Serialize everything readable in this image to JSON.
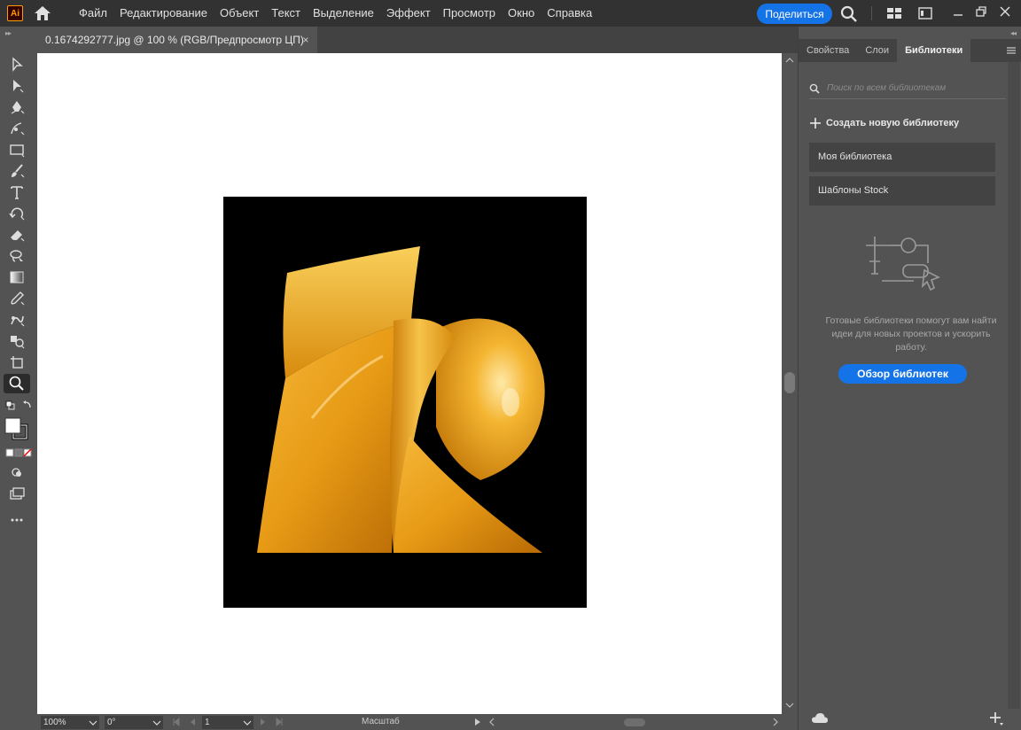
{
  "app": {
    "logo": "Ai",
    "menu": [
      "Файл",
      "Редактирование",
      "Объект",
      "Текст",
      "Выделение",
      "Эффект",
      "Просмотр",
      "Окно",
      "Справка"
    ],
    "share_label": "Поделиться",
    "accent": "#1473e6"
  },
  "document": {
    "tab_title": "0.1674292777.jpg @ 100 % (RGB/Предпросмотр ЦП)",
    "close_glyph": "×"
  },
  "status": {
    "zoom": "100%",
    "rotation": "0°",
    "page": "1",
    "scale_label": "Масштаб"
  },
  "panel": {
    "tabs": [
      "Свойства",
      "Слои",
      "Библиотеки"
    ],
    "active_tab": "Библиотеки",
    "search_placeholder": "Поиск по всем библиотекам",
    "create_label": "Создать новую библиотеку",
    "libraries": [
      "Моя библиотека",
      "Шаблоны Stock"
    ],
    "empty_text": "Готовые библиотеки помогут вам найти идеи для новых проектов и ускорить работу.",
    "browse_label": "Обзор библиотек"
  },
  "icons": {
    "tools": [
      "selection-tool-icon",
      "direct-selection-tool-icon",
      "pen-tool-icon",
      "curvature-tool-icon",
      "rectangle-tool-icon",
      "paintbrush-tool-icon",
      "type-tool-icon",
      "rotate-tool-icon",
      "eraser-tool-icon",
      "lasso-tool-icon",
      "gradient-tool-icon",
      "eyedropper-tool-icon",
      "puppet-warp-tool-icon",
      "shape-builder-tool-icon",
      "artboard-tool-icon",
      "zoom-tool-icon"
    ]
  }
}
